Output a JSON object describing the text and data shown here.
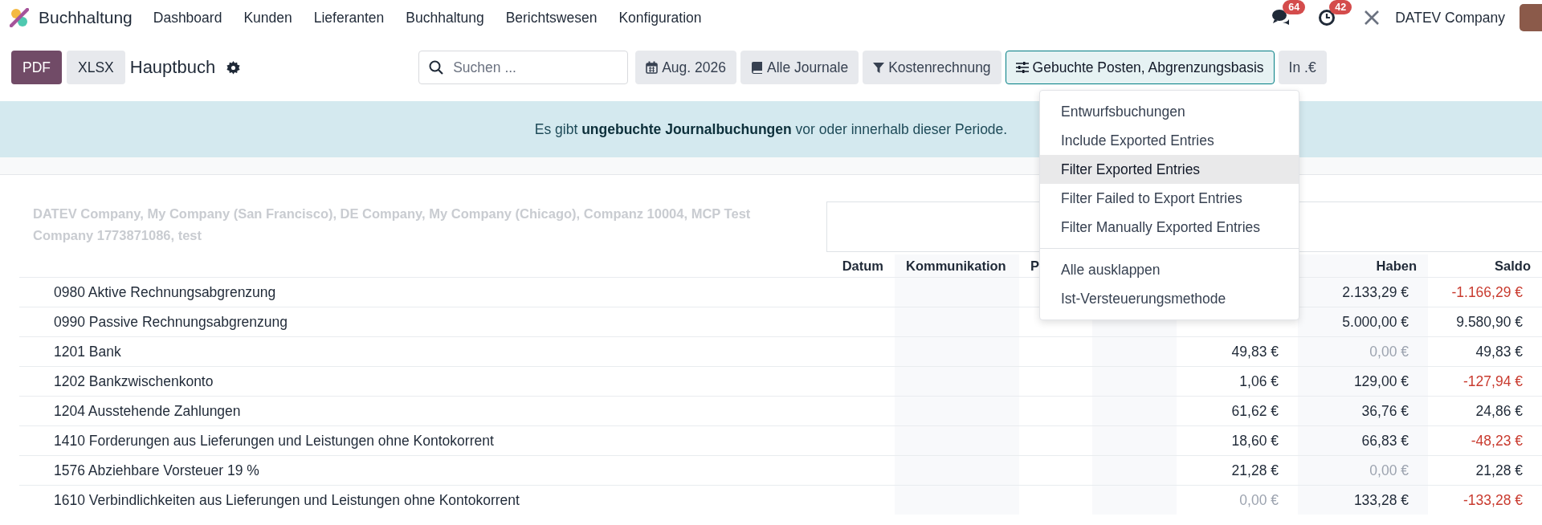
{
  "navbar": {
    "app_name": "Buchhaltung",
    "menus": [
      "Dashboard",
      "Kunden",
      "Lieferanten",
      "Buchhaltung",
      "Berichtswesen",
      "Konfiguration"
    ],
    "messages_badge": "64",
    "activities_badge": "42",
    "company": "DATEV Company"
  },
  "control_bar": {
    "buttons": [
      {
        "label": "PDF",
        "kind": "primary"
      },
      {
        "label": "XLSX",
        "kind": "secondary"
      }
    ],
    "title": "Hauptbuch",
    "search": {
      "placeholder": "Suchen ..."
    },
    "filters": [
      {
        "label": "Aug. 2026",
        "kind": "calendar",
        "selected": false
      },
      {
        "label": "Alle Journale",
        "kind": "book",
        "selected": false
      },
      {
        "label": "Kostenrechnung",
        "kind": "filter",
        "selected": false
      },
      {
        "label": "Gebuchte Posten, Abgrenzungsbasis",
        "kind": "sliders",
        "selected": true
      },
      {
        "label": "In .€",
        "kind": "plain",
        "selected": false
      }
    ]
  },
  "dropdown": {
    "groups": [
      [
        {
          "label": "Entwurfsbuchungen",
          "selected": false
        },
        {
          "label": "Include Exported Entries",
          "selected": false
        },
        {
          "label": "Filter Exported Entries",
          "selected": true
        },
        {
          "label": "Filter Failed to Export Entries",
          "selected": false
        },
        {
          "label": "Filter Manually Exported Entries",
          "selected": false
        }
      ],
      [
        {
          "label": "Alle ausklappen",
          "selected": false
        },
        {
          "label": "Ist-Versteuerungsmethode",
          "selected": false
        }
      ]
    ]
  },
  "alert": {
    "before": "Es gibt ",
    "link": "ungebuchte Journalbuchungen",
    "after": " vor oder innerhalb dieser Periode."
  },
  "report": {
    "companies": "DATEV Company, My Company (San Francisco), DE Company, My Company (Chicago), Companz 10004, MCP Test Company 1773871086, test",
    "columns": {
      "datum": "Datum",
      "kommunikation": "Kommunikation",
      "column_3": "P",
      "haben": "Haben",
      "saldo": "Saldo"
    },
    "rows": [
      {
        "account": "0980 Aktive Rechnungsabgrenzung",
        "credit": {
          "text": "2.133,29 €",
          "muted": false
        },
        "balance": {
          "text": "-1.166,29 €",
          "negative": true
        }
      },
      {
        "account": "0990 Passive Rechnungsabgrenzung",
        "credit": {
          "text": "5.000,00 €",
          "muted": false
        },
        "balance": {
          "text": "9.580,90 €",
          "negative": false
        }
      },
      {
        "account": "1201 Bank",
        "debit": {
          "text": "49,83 €",
          "muted": false
        },
        "credit": {
          "text": "0,00 €",
          "muted": true
        },
        "balance": {
          "text": "49,83 €",
          "negative": false
        }
      },
      {
        "account": "1202 Bankzwischenkonto",
        "debit": {
          "text": "1,06 €",
          "muted": false
        },
        "credit": {
          "text": "129,00 €",
          "muted": false
        },
        "balance": {
          "text": "-127,94 €",
          "negative": true
        }
      },
      {
        "account": "1204 Ausstehende Zahlungen",
        "debit": {
          "text": "61,62 €",
          "muted": false
        },
        "credit": {
          "text": "36,76 €",
          "muted": false
        },
        "balance": {
          "text": "24,86 €",
          "negative": false
        }
      },
      {
        "account": "1410 Forderungen aus Lieferungen und Leistungen ohne Kontokorrent",
        "debit": {
          "text": "18,60 €",
          "muted": false
        },
        "credit": {
          "text": "66,83 €",
          "muted": false
        },
        "balance": {
          "text": "-48,23 €",
          "negative": true
        }
      },
      {
        "account": "1576 Abziehbare Vorsteuer 19 %",
        "debit": {
          "text": "21,28 €",
          "muted": false
        },
        "credit": {
          "text": "0,00 €",
          "muted": true
        },
        "balance": {
          "text": "21,28 €",
          "negative": false
        }
      },
      {
        "account": "1610 Verbindlichkeiten aus Lieferungen und Leistungen ohne Kontokorrent",
        "debit": {
          "text": "0,00 €",
          "muted": true
        },
        "credit": {
          "text": "133,28 €",
          "muted": false
        },
        "balance": {
          "text": "-133,28 €",
          "negative": true
        }
      }
    ]
  }
}
